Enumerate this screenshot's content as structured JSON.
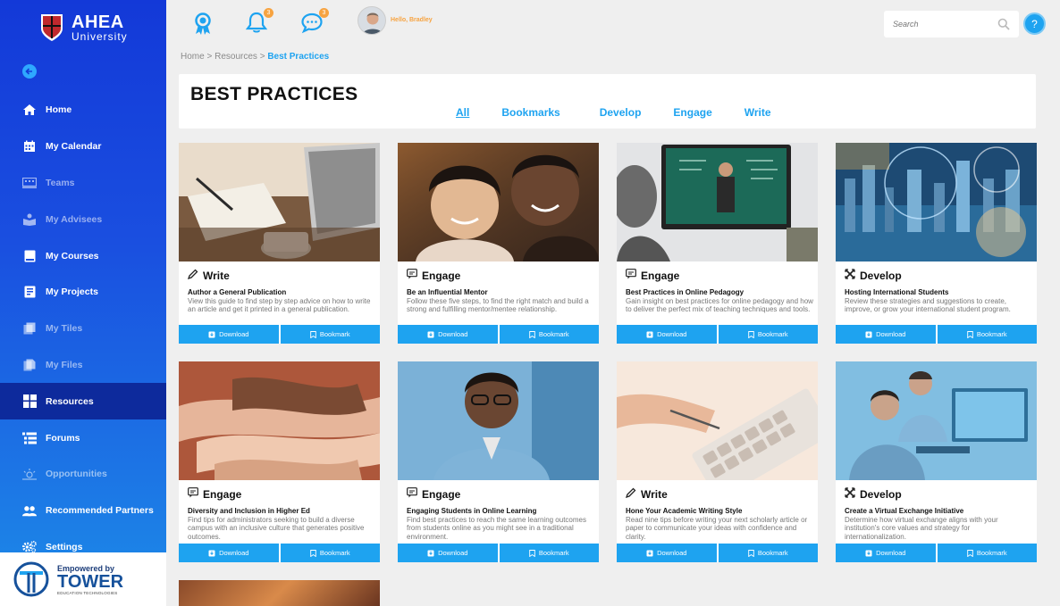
{
  "brand": {
    "title": "AHEA",
    "subtitle": "University",
    "crest_letters": "AHEA"
  },
  "sidebar": {
    "items": [
      {
        "label": "Home",
        "icon": "home-icon",
        "state": "normal"
      },
      {
        "label": "My Calendar",
        "icon": "calendar-icon",
        "state": "normal"
      },
      {
        "label": "Teams",
        "icon": "teams-icon",
        "state": "dim"
      },
      {
        "label": "My Advisees",
        "icon": "advisees-icon",
        "state": "dim"
      },
      {
        "label": "My Courses",
        "icon": "courses-icon",
        "state": "normal"
      },
      {
        "label": "My Projects",
        "icon": "projects-icon",
        "state": "normal"
      },
      {
        "label": "My Tiles",
        "icon": "tiles-icon",
        "state": "dim"
      },
      {
        "label": "My Files",
        "icon": "files-icon",
        "state": "dim"
      },
      {
        "label": "Resources",
        "icon": "resources-icon",
        "state": "active"
      },
      {
        "label": "Forums",
        "icon": "forums-icon",
        "state": "normal"
      },
      {
        "label": "Opportunities",
        "icon": "opportunities-icon",
        "state": "dim"
      },
      {
        "label": "Recommended Partners",
        "icon": "partners-icon",
        "state": "normal"
      },
      {
        "label": "Settings",
        "icon": "settings-icon",
        "state": "normal"
      }
    ],
    "powered_by": {
      "top": "Empowered by",
      "brand": "TOWER",
      "small": "EDUCATION TECHNOLOGIES"
    }
  },
  "topbar": {
    "notifications_count": "3",
    "messages_count": "3",
    "greeting": "Hello, Bradley",
    "search_placeholder": "Search",
    "help_label": "?"
  },
  "breadcrumb": {
    "items": [
      "Home",
      "Resources"
    ],
    "current": "Best Practices",
    "separator": ">"
  },
  "page": {
    "title": "BEST PRACTICES",
    "tabs": [
      {
        "label": "All",
        "active": true
      },
      {
        "label": "Bookmarks",
        "active": false
      },
      {
        "label": "Develop",
        "active": false
      },
      {
        "label": "Engage",
        "active": false
      },
      {
        "label": "Write",
        "active": false
      }
    ]
  },
  "buttons": {
    "download": "Download",
    "bookmark": "Bookmark"
  },
  "cards": [
    {
      "category": "Write",
      "cat_icon": "pencil-icon",
      "title": "Author a General Publication",
      "desc": "View this guide to find step by step advice on how to write an article and get it printed in a general publication.",
      "image": "laptop-notebook-coffee"
    },
    {
      "category": "Engage",
      "cat_icon": "chat-icon",
      "title": "Be an Influential Mentor",
      "desc": "Follow these five steps, to find the right match and build a strong and fulfilling mentor/mentee relationship.",
      "image": "two-people-smiling"
    },
    {
      "category": "Engage",
      "cat_icon": "chat-icon",
      "title": "Best Practices in Online Pedagogy",
      "desc": "Gain insight on best practices for online pedagogy and how to deliver the perfect mix of teaching techniques and tools.",
      "image": "online-lecture-screen"
    },
    {
      "category": "Develop",
      "cat_icon": "develop-icon",
      "title": "Hosting International Students",
      "desc": "Review these strategies and suggestions to create, improve, or grow your international student program.",
      "image": "global-city-network"
    },
    {
      "category": "Engage",
      "cat_icon": "chat-icon",
      "title": "Diversity and Inclusion in Higher Ed",
      "desc": "Find tips for administrators seeking to build a diverse campus with an inclusive culture that generates positive outcomes.",
      "image": "stacked-hands"
    },
    {
      "category": "Engage",
      "cat_icon": "chat-icon",
      "title": "Engaging Students in Online Learning",
      "desc": "Find best practices to reach the same learning outcomes from students online as you might see in a traditional environment.",
      "image": "student-with-glasses"
    },
    {
      "category": "Write",
      "cat_icon": "pencil-icon",
      "title": "Hone Your Academic Writing Style",
      "desc": "Read nine tips before writing your next scholarly article or paper to communicate your ideas with confidence and clarity.",
      "image": "writing-keyboard"
    },
    {
      "category": "Develop",
      "cat_icon": "develop-icon",
      "title": "Create a Virtual Exchange Initiative",
      "desc": "Determine how virtual exchange aligns with your institution's core values and strategy for internationalization.",
      "image": "coworkers-at-computer"
    }
  ]
}
